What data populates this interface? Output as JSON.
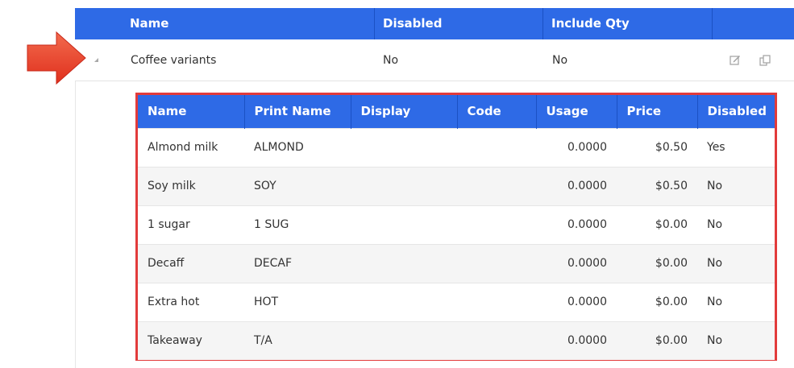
{
  "outer_table": {
    "columns": [
      "Name",
      "Disabled",
      "Include Qty"
    ],
    "row": {
      "name": "Coffee variants",
      "disabled": "No",
      "include_qty": "No",
      "actions": [
        "edit-icon",
        "copy-icon"
      ]
    }
  },
  "inner_table": {
    "columns": [
      "Name",
      "Print Name",
      "Display",
      "Code",
      "Usage",
      "Price",
      "Disabled"
    ],
    "rows": [
      {
        "name": "Almond milk",
        "print_name": "ALMOND",
        "display": "",
        "code": "",
        "usage": "0.0000",
        "price": "$0.50",
        "disabled": "Yes"
      },
      {
        "name": "Soy milk",
        "print_name": "SOY",
        "display": "",
        "code": "",
        "usage": "0.0000",
        "price": "$0.50",
        "disabled": "No"
      },
      {
        "name": "1 sugar",
        "print_name": "1 SUG",
        "display": "",
        "code": "",
        "usage": "0.0000",
        "price": "$0.00",
        "disabled": "No"
      },
      {
        "name": "Decaff",
        "print_name": "DECAF",
        "display": "",
        "code": "",
        "usage": "0.0000",
        "price": "$0.00",
        "disabled": "No"
      },
      {
        "name": "Extra hot",
        "print_name": "HOT",
        "display": "",
        "code": "",
        "usage": "0.0000",
        "price": "$0.00",
        "disabled": "No"
      },
      {
        "name": "Takeaway",
        "print_name": "T/A",
        "display": "",
        "code": "",
        "usage": "0.0000",
        "price": "$0.00",
        "disabled": "No"
      }
    ]
  },
  "colors": {
    "header_blue": "#2e6ae6",
    "highlight_red": "#e23b3b",
    "arrow_red": "#f0432e"
  }
}
